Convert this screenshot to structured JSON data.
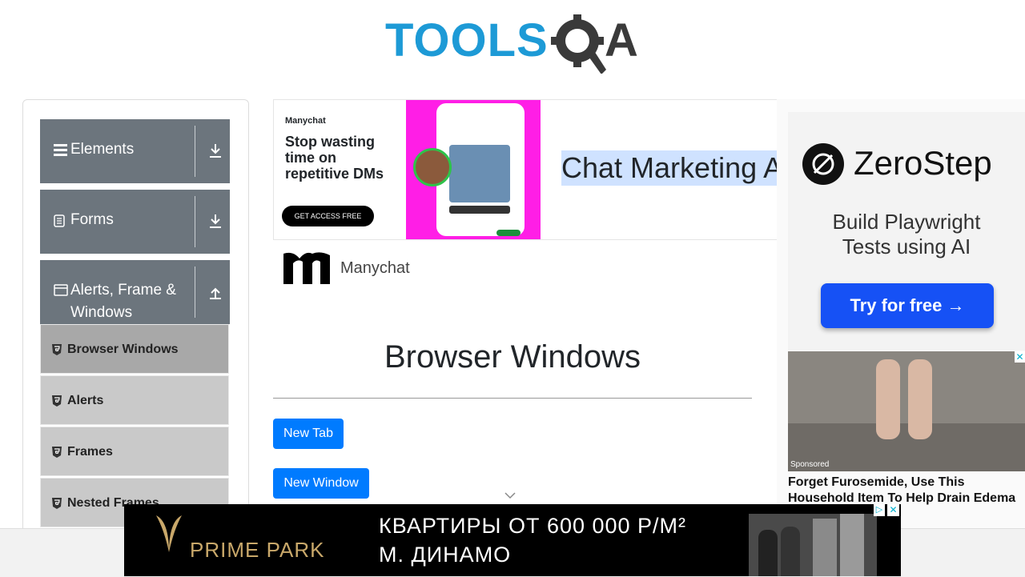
{
  "header": {
    "logo_alt": "TOOLSQA"
  },
  "sidebar": {
    "groups": [
      {
        "label": "Elements",
        "icon": "hamburger-icon",
        "arrow": "download-icon"
      },
      {
        "label": "Forms",
        "icon": "document-icon",
        "arrow": "download-icon"
      },
      {
        "label": "Alerts, Frame &",
        "label2": "Windows",
        "icon": "window-icon",
        "arrow": "upload-icon"
      }
    ],
    "items": [
      {
        "label": "Browser Windows",
        "active": true
      },
      {
        "label": "Alerts"
      },
      {
        "label": "Frames"
      },
      {
        "label": "Nested Frames"
      }
    ]
  },
  "top_ad": {
    "brand": "Manychat",
    "headline": "Stop wasting time on repetitive DMs",
    "cta": "GET ACCESS FREE",
    "title": "Chat Marketing A",
    "advertiser": "Manychat"
  },
  "main": {
    "page_title": "Browser Windows",
    "new_tab_label": "New Tab",
    "new_window_label": "New Window"
  },
  "right_ad": {
    "brand": "ZeroStep",
    "tagline_1": "Build Playwright",
    "tagline_2": "Tests using AI",
    "cta": "Try for free →",
    "sponsored": "Sponsored",
    "headline_1": "Forget Furosemide, Use This",
    "headline_2": "Household Item To Help Drain Edema"
  },
  "bottom_ad": {
    "brand": "PRIME PARK",
    "line_1": "КВАРТИРЫ ОТ 600 000 Р/М²",
    "line_2": "М. ДИНАМО"
  },
  "colors": {
    "accent": "#007bff",
    "sidebar_group": "#6c757d",
    "logo_blue": "#1d9ad6",
    "logo_dark": "#3a3a3a"
  }
}
